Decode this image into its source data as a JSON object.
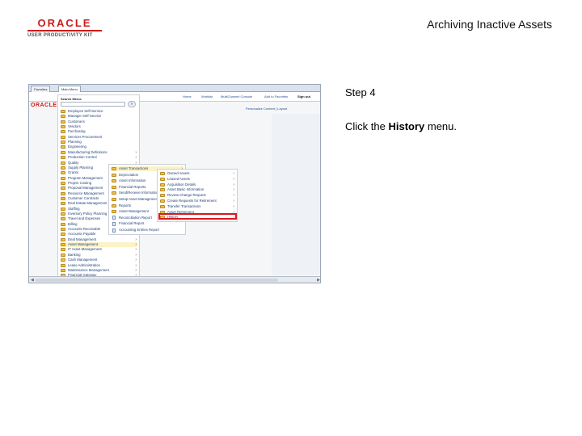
{
  "header": {
    "logo_top": "ORACLE",
    "logo_bottom": "USER PRODUCTIVITY KIT",
    "slide_title": "Archiving Inactive Assets"
  },
  "instructions": {
    "step": "Step 4",
    "text_before": "Click the ",
    "target": "History",
    "text_after": " menu."
  },
  "screenshot": {
    "tabs": [
      "Favorites",
      "Main Menu"
    ],
    "toolbar_links": [
      "Home",
      "Worklist",
      "MultiChannel Console",
      "Add to Favorites",
      "Sign out"
    ],
    "brand": "ORACLE",
    "personalize": "Personalize Content | Layout",
    "search": {
      "label": "Search Menu:",
      "button": "»"
    },
    "main_menu": [
      {
        "label": "Employee Self-Service",
        "sub": false
      },
      {
        "label": "Manager Self-Service",
        "sub": false
      },
      {
        "label": "Customers",
        "sub": false
      },
      {
        "label": "Vendors",
        "sub": false
      },
      {
        "label": "Purchasing",
        "sub": false
      },
      {
        "label": "Services Procurement",
        "sub": false
      },
      {
        "label": "Planning",
        "sub": false
      },
      {
        "label": "Engineering",
        "sub": false
      },
      {
        "label": "Manufacturing Definitions",
        "sub": true
      },
      {
        "label": "Production Control",
        "sub": true
      },
      {
        "label": "Quality",
        "sub": true
      },
      {
        "label": "Supply Planning",
        "sub": true
      },
      {
        "label": "Grants",
        "sub": false
      },
      {
        "label": "Program Management",
        "sub": false
      },
      {
        "label": "Project Costing",
        "sub": true
      },
      {
        "label": "Proposal Management",
        "sub": true
      },
      {
        "label": "Resource Management",
        "sub": true
      },
      {
        "label": "Customer Contracts",
        "sub": true
      },
      {
        "label": "Real Estate Management",
        "sub": true
      },
      {
        "label": "Staffing",
        "sub": true
      },
      {
        "label": "Inventory Policy Planning",
        "sub": true
      },
      {
        "label": "Travel and Expenses",
        "sub": true
      },
      {
        "label": "Billing",
        "sub": true
      },
      {
        "label": "Accounts Receivable",
        "sub": true
      },
      {
        "label": "Accounts Payable",
        "sub": true
      },
      {
        "label": "Deal Management",
        "sub": true
      },
      {
        "label": "Asset Management",
        "sub": true
      },
      {
        "label": "IT Asset Management",
        "sub": true
      },
      {
        "label": "Banking",
        "sub": true
      },
      {
        "label": "Cash Management",
        "sub": true
      },
      {
        "label": "Lease Administration",
        "sub": true
      },
      {
        "label": "Maintenance Management",
        "sub": true
      },
      {
        "label": "Financial Gateway",
        "sub": true
      }
    ],
    "asset_menu": [
      {
        "label": "Asset Transactions",
        "sub": true,
        "doc": false
      },
      {
        "label": "Depreciation",
        "sub": true,
        "doc": false
      },
      {
        "label": "Asset Information",
        "sub": true,
        "doc": false
      },
      {
        "label": "Financial Reports",
        "sub": true,
        "doc": false
      },
      {
        "label": "Send/Receive Information",
        "sub": true,
        "doc": false
      },
      {
        "label": "Setup Asset Management",
        "sub": true,
        "doc": false
      },
      {
        "label": "Reports",
        "sub": true,
        "doc": false
      },
      {
        "label": "Asset Management",
        "sub": true,
        "doc": false
      },
      {
        "label": "Reconciliation Report",
        "sub": false,
        "doc": true
      },
      {
        "label": "Financial Report",
        "sub": false,
        "doc": true
      },
      {
        "label": "Accounting Entries Report",
        "sub": false,
        "doc": true
      }
    ],
    "transactions_menu": [
      {
        "label": "Owned Assets",
        "sub": true
      },
      {
        "label": "Leased Assets",
        "sub": true
      },
      {
        "label": "Acquisition Details",
        "sub": true
      },
      {
        "label": "Asset Basic Information",
        "sub": true
      },
      {
        "label": "Review Change Request",
        "sub": true
      },
      {
        "label": "Create Requests for Retirement",
        "sub": true
      },
      {
        "label": "Transfer Transactions",
        "sub": true
      },
      {
        "label": "Asset Retirement",
        "sub": true
      },
      {
        "label": "History",
        "sub": true
      }
    ]
  }
}
